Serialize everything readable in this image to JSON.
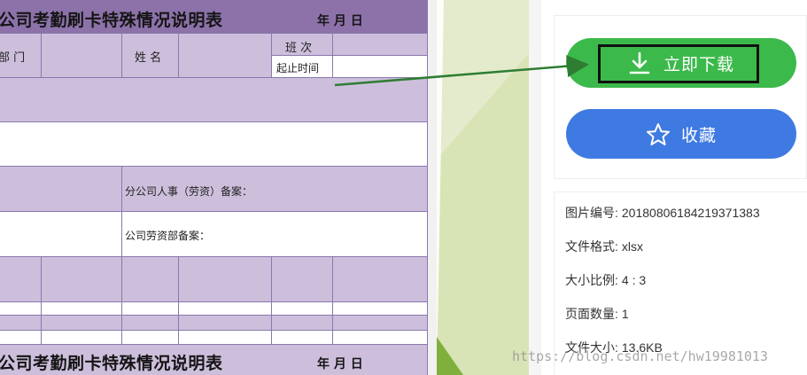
{
  "sheet": {
    "title": "公司考勤刷卡特殊情况说明表",
    "date_label": "年 月 日",
    "dept_label": "部 门",
    "name_label": "姓 名",
    "shift_label": "班 次",
    "period_label": "起止时间",
    "branch_hr_label": "分公司人事（劳资）备案：",
    "company_labor_label": "公司劳资部备案："
  },
  "sidebar": {
    "download_label": "立即下载",
    "favorite_label": "收藏",
    "info": [
      {
        "key": "图片编号:",
        "value": "20180806184219371383"
      },
      {
        "key": "文件格式:",
        "value": "xlsx"
      },
      {
        "key": "大小比例:",
        "value": "4 : 3"
      },
      {
        "key": "页面数量:",
        "value": "1"
      },
      {
        "key": "文件大小:",
        "value": "13.6KB"
      }
    ]
  },
  "watermark": "https://blog.csdn.net/hw19981013",
  "colors": {
    "download": "#3cb94b",
    "favorite": "#3f7ae2",
    "sheet_dark": "#8d72aa",
    "sheet_light": "#cdbfdc",
    "arrow": "#2e7d32"
  },
  "icons": {
    "download": "download-icon",
    "favorite": "star-icon"
  }
}
